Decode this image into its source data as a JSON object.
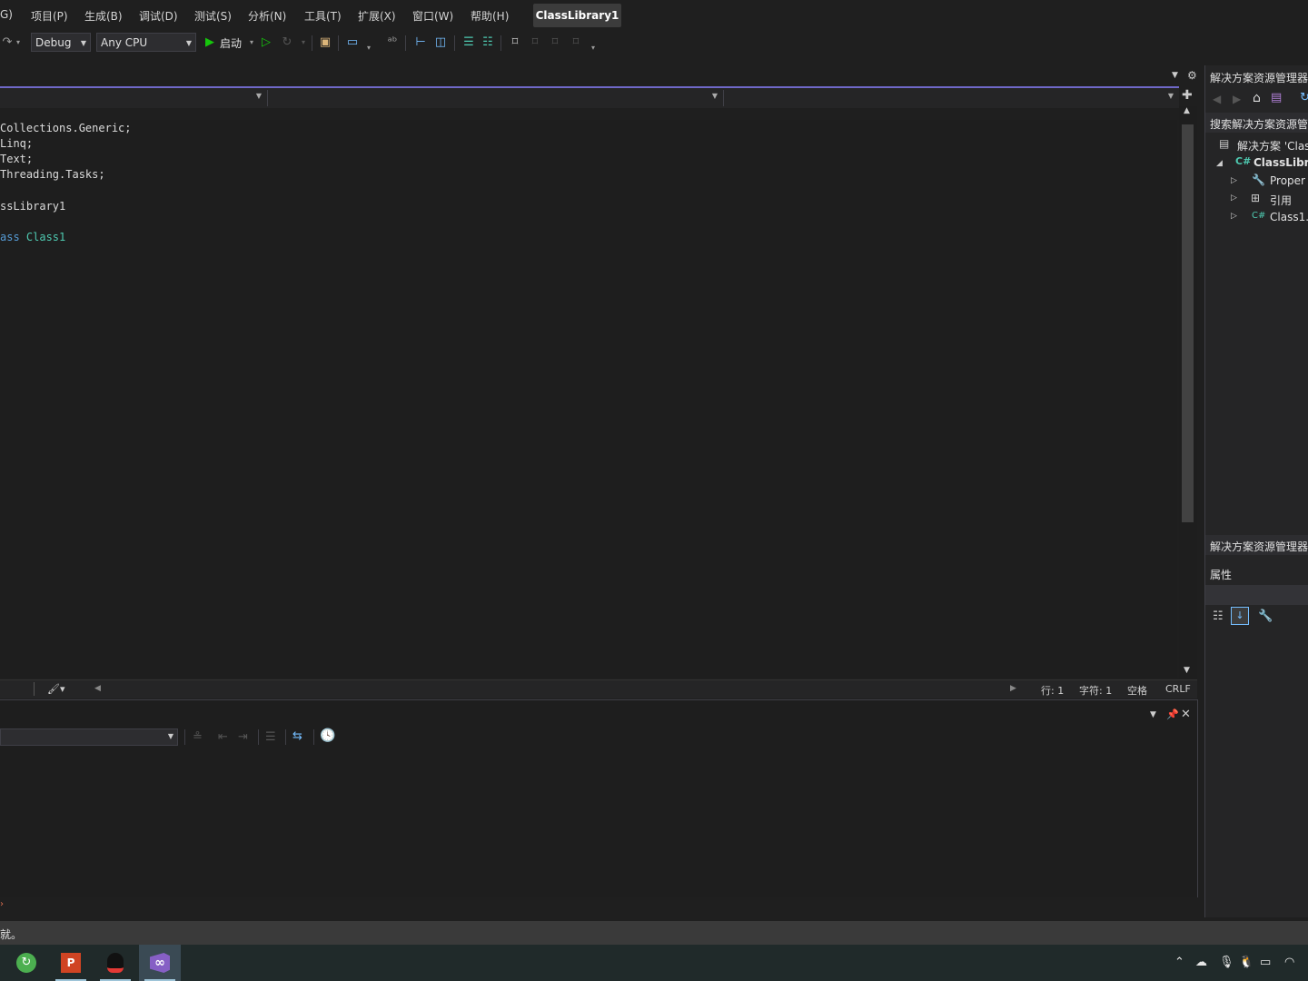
{
  "menu": {
    "items": [
      "G)",
      "项目(P)",
      "生成(B)",
      "调试(D)",
      "测试(S)",
      "分析(N)",
      "工具(T)",
      "扩展(X)",
      "窗口(W)",
      "帮助(H)"
    ],
    "solution_title": "ClassLibrary1"
  },
  "toolbar": {
    "config": "Debug",
    "platform": "Any CPU",
    "start_label": "启动"
  },
  "editor": {
    "code_lines": [
      {
        "prefix": "Collections.Generic;",
        "keyword": "",
        "type": ""
      },
      {
        "prefix": "Linq;",
        "keyword": "",
        "type": ""
      },
      {
        "prefix": "Text;",
        "keyword": "",
        "type": ""
      },
      {
        "prefix": "Threading.Tasks;",
        "keyword": "",
        "type": ""
      },
      {
        "prefix": "",
        "keyword": "",
        "type": ""
      },
      {
        "prefix": "ssLibrary1",
        "keyword": "",
        "type": ""
      },
      {
        "prefix": "",
        "keyword": "",
        "type": ""
      },
      {
        "prefix": "",
        "keyword": "ass ",
        "type": "Class1"
      }
    ],
    "status": {
      "line": "行: 1",
      "char": "字符: 1",
      "spaces": "空格",
      "eol": "CRLF"
    }
  },
  "solution_explorer": {
    "title": "解决方案资源管理器",
    "search": "搜索解决方案资源管",
    "solution_node": "解决方案 'Clas",
    "project_node": "ClassLibra",
    "children": [
      "Proper",
      "引用",
      "Class1.c"
    ],
    "footer_tab": "解决方案资源管理器"
  },
  "properties": {
    "title": "属性"
  },
  "app_status": {
    "text": "就。"
  },
  "colors": {
    "accent": "#6f68c7",
    "keyword": "#569cd6",
    "type": "#4ec9b0",
    "play": "#16c60c"
  }
}
